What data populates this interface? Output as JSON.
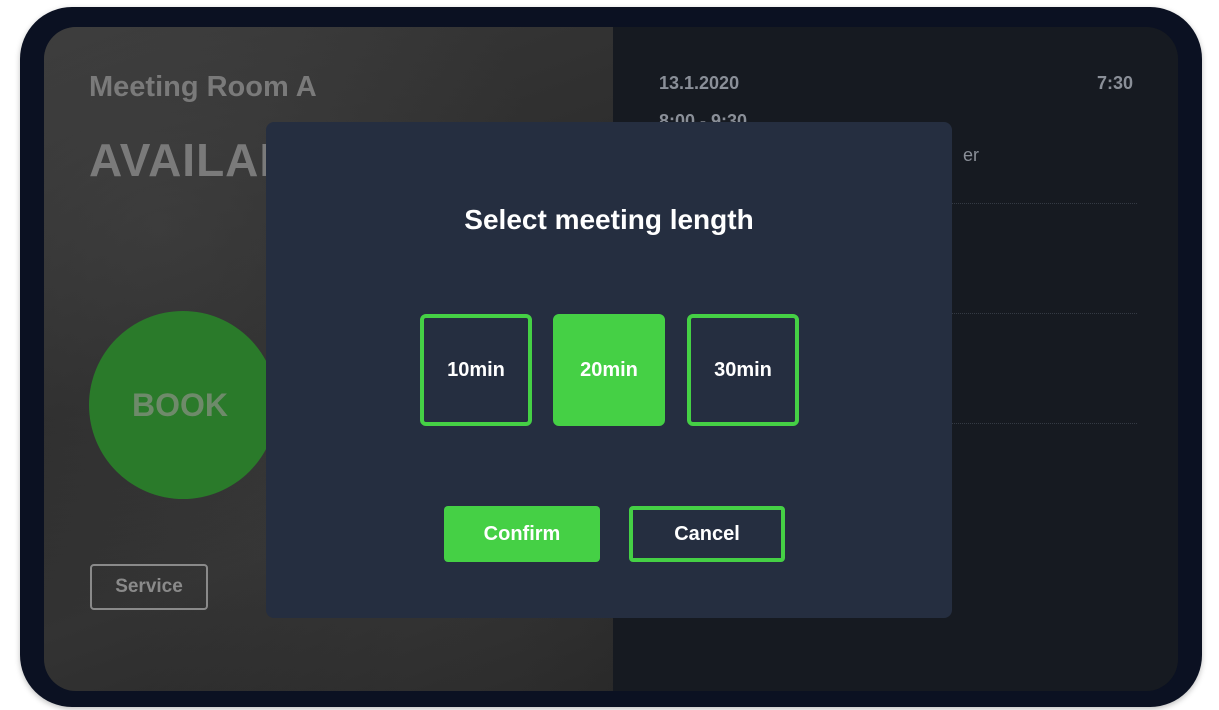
{
  "room": {
    "name": "Meeting Room A",
    "status": "AVAILABLE",
    "book_label": "BOOK",
    "service_label": "Service"
  },
  "schedule": {
    "date": "13.1.2020",
    "time": "7:30",
    "slot_time": "8:00 - 9:30",
    "slot_name": "er"
  },
  "modal": {
    "title": "Select meeting length",
    "options": [
      {
        "label": "10min",
        "selected": false
      },
      {
        "label": "20min",
        "selected": true
      },
      {
        "label": "30min",
        "selected": false
      }
    ],
    "confirm_label": "Confirm",
    "cancel_label": "Cancel"
  },
  "colors": {
    "accent": "#45d045",
    "modal_bg": "#252e40",
    "device_frame": "#0b1122"
  }
}
